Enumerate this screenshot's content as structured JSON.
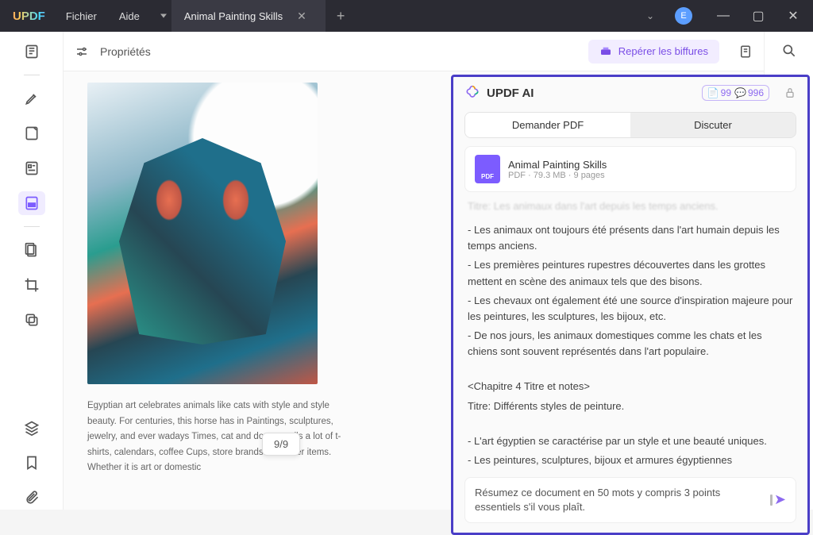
{
  "titlebar": {
    "logo": "UPDF",
    "menu": [
      "Fichier",
      "Aide"
    ],
    "tab": "Animal Painting Skills",
    "avatar": "E"
  },
  "topbar": {
    "properties": "Propriétés",
    "reveal": "Repérer les biffures"
  },
  "document": {
    "page_indicator": "9/9",
    "body_text": "Egyptian art celebrates animals like cats with style and style beauty. For centuries, this horse has in Paintings, sculptures, jewelry, and ever wadays Times, cat and dog art sells a lot of t-shirts, calendars, coffee Cups, store brands and other items. Whether it is art or domestic"
  },
  "ai": {
    "title": "UPDF AI",
    "credits_a": "99",
    "credits_b": "996",
    "tabs": {
      "ask": "Demander PDF",
      "chat": "Discuter"
    },
    "file": {
      "name": "Animal Painting Skills",
      "meta": "PDF · 79.3 MB · 9 pages",
      "badge": "PDF"
    },
    "chat": {
      "blur": "Titre: Les animaux dans l'art depuis les temps anciens.",
      "lines": [
        "- Les animaux ont toujours été présents dans l'art humain depuis les temps anciens.",
        "- Les premières peintures rupestres découvertes dans les grottes mettent en scène des animaux tels que des bisons.",
        "- Les chevaux ont également été une source d'inspiration majeure pour les peintures, les sculptures, les bijoux, etc.",
        "- De nos jours, les animaux domestiques comme les chats et les chiens sont souvent représentés dans l'art populaire."
      ],
      "chapter": "<Chapitre 4 Titre et notes>",
      "subtitle": "Titre: Différents styles de peinture.",
      "lines2": [
        "- L'art égyptien se caractérise par un style et une beauté uniques.",
        "- Les peintures, sculptures, bijoux et armures égyptiennes"
      ]
    },
    "input": "Résumez ce document en 50 mots y compris 3 points essentiels s'il vous plaît."
  },
  "right_tools": {
    "ocr": "OCR"
  }
}
